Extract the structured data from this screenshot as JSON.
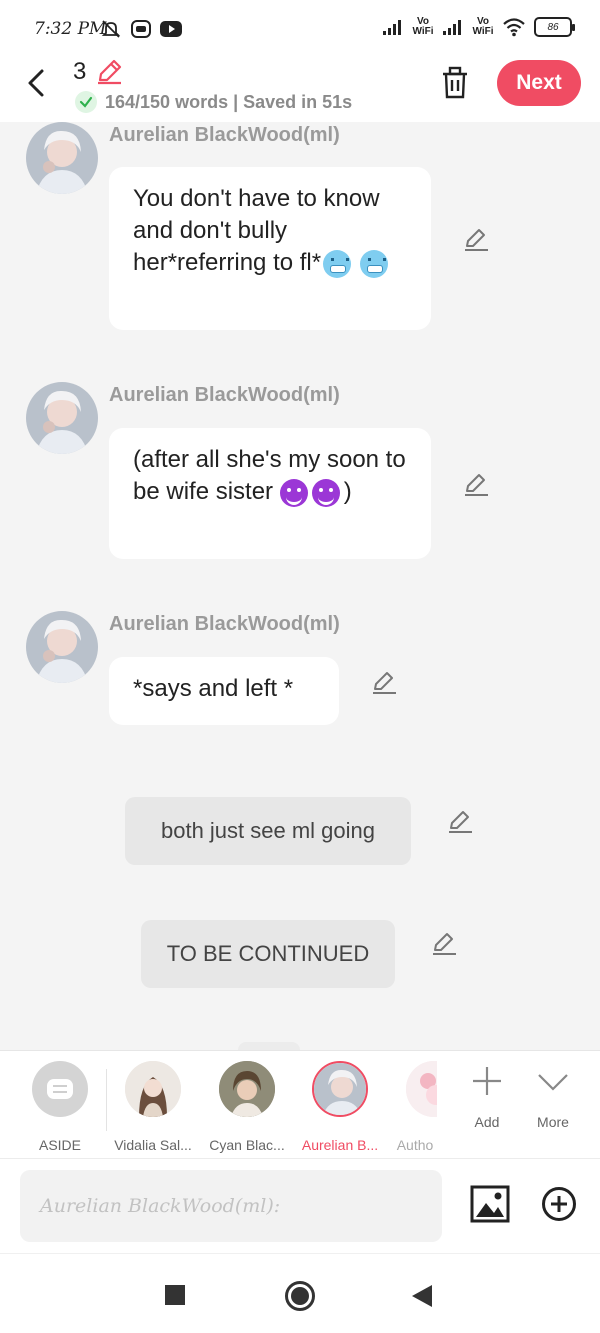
{
  "status_bar": {
    "time": "7:32 PM",
    "vowifi_1": "Vo WiFi",
    "vowifi_2": "Vo WiFi",
    "battery": "86"
  },
  "header": {
    "chapter_number": "3",
    "save_status": "164/150 words | Saved in 51s",
    "next_label": "Next"
  },
  "messages": [
    {
      "sender": "Aurelian BlackWood(ml)",
      "text": "You don't have to know and don't bully her*referring to fl*"
    },
    {
      "sender": "Aurelian BlackWood(ml)",
      "text": "(after all she's my soon to be wife sister"
    },
    {
      "sender": "Aurelian BlackWood(ml)",
      "text": "*says and left *"
    }
  ],
  "asides": [
    {
      "text": "both just see ml going"
    },
    {
      "text": "TO BE CONTINUED"
    }
  ],
  "characters": [
    {
      "name": "ASIDE"
    },
    {
      "name": "Vidalia Sal..."
    },
    {
      "name": "Cyan Blac..."
    },
    {
      "name": "Aurelian B..."
    },
    {
      "name": "Autho"
    }
  ],
  "tools": {
    "add_label": "Add",
    "more_label": "More"
  },
  "input": {
    "placeholder": "Aurelian BlackWood(ml):"
  },
  "colors": {
    "accent": "#f04c63",
    "bubble": "#ffffff",
    "aside_bubble": "#e7e7e7",
    "background": "#f4f4f4"
  }
}
